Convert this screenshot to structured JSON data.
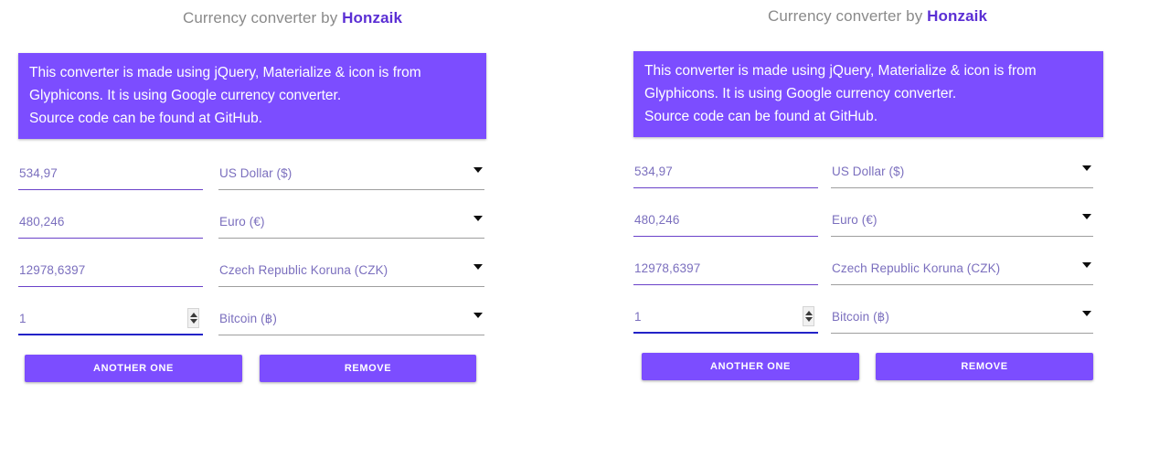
{
  "page": {
    "background": "#ffffff",
    "accent_purple": "#7c4dff",
    "brand_purple": "#5b2fd4",
    "focus_blue": "#2222c7",
    "underline_purple": "#6a42c9",
    "underline_gray": "#9e9e9e"
  },
  "title": {
    "prefix": "Currency converter by ",
    "brand": "Honzaik"
  },
  "info_card": {
    "line1": "This converter is made using jQuery, Materialize & icon is from",
    "line2": "Glyphicons. It is using Google currency converter.",
    "line3": "Source code can be found at GitHub."
  },
  "rows": [
    {
      "amount": "534,97",
      "currency": "US Dollar ($)",
      "focused": false,
      "has_spinner": false,
      "caret_icon": "chevron-down-icon"
    },
    {
      "amount": "480,246",
      "currency": "Euro (€)",
      "focused": false,
      "has_spinner": false,
      "caret_icon": "chevron-down-icon"
    },
    {
      "amount": "12978,6397",
      "currency": "Czech Republic Koruna (CZK)",
      "focused": false,
      "has_spinner": false,
      "caret_icon": "chevron-down-icon"
    },
    {
      "amount": "1",
      "currency": "Bitcoin (฿)",
      "focused": true,
      "has_spinner": true,
      "caret_icon": "chevron-down-icon",
      "spinner_icon": "number-stepper-icon"
    }
  ],
  "buttons": {
    "another": "ANOTHER ONE",
    "remove": "REMOVE"
  }
}
